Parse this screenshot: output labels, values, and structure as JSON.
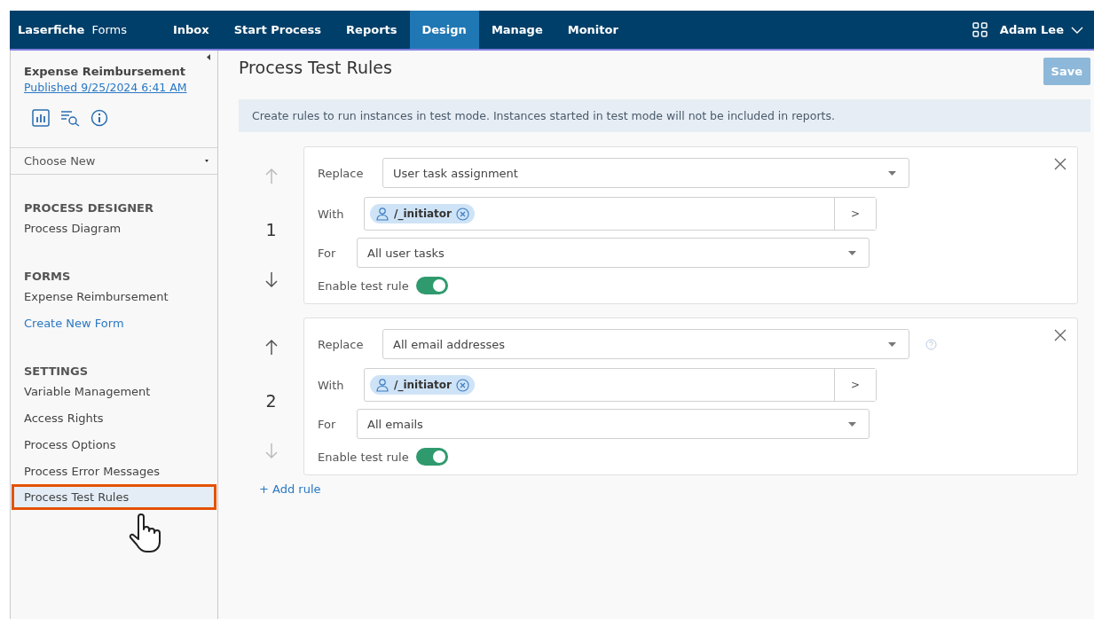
{
  "nav": {
    "brand": "Laserfiche",
    "product": "Forms",
    "tabs": [
      {
        "label": "Inbox",
        "selected": false
      },
      {
        "label": "Start Process",
        "selected": false
      },
      {
        "label": "Reports",
        "selected": false
      },
      {
        "label": "Design",
        "selected": true
      },
      {
        "label": "Manage",
        "selected": false
      },
      {
        "label": "Monitor",
        "selected": false
      }
    ],
    "user": "Adam Lee"
  },
  "sidebar": {
    "process_name": "Expense Reimbursement",
    "published": "Published 9/25/2024 6:41 AM",
    "choose": "Choose New",
    "sections": [
      {
        "heading": "PROCESS DESIGNER",
        "items": [
          {
            "label": "Process Diagram",
            "kind": "page",
            "selected": false
          }
        ]
      },
      {
        "heading": "FORMS",
        "items": [
          {
            "label": "Expense Reimbursement",
            "kind": "page",
            "selected": false
          },
          {
            "label": "Create New Form",
            "kind": "link",
            "selected": false
          }
        ]
      },
      {
        "heading": "SETTINGS",
        "items": [
          {
            "label": "Variable Management",
            "kind": "page",
            "selected": false
          },
          {
            "label": "Access Rights",
            "kind": "page",
            "selected": false
          },
          {
            "label": "Process Options",
            "kind": "page",
            "selected": false
          },
          {
            "label": "Process Error Messages",
            "kind": "page",
            "selected": false
          },
          {
            "label": "Process Test Rules",
            "kind": "page",
            "selected": true
          }
        ]
      }
    ]
  },
  "main": {
    "title": "Process Test Rules",
    "save": {
      "label": "Save",
      "disabled": true
    },
    "info": "Create rules to run instances in test mode. Instances started in test mode will not be included in reports.",
    "rules": [
      {
        "number": "1",
        "up_disabled": true,
        "down_disabled": false,
        "replace_label": "Replace",
        "replace": "User task assignment",
        "help": false,
        "with_label": "With",
        "with": "/_initiator",
        "browse": ">",
        "for_label": "For",
        "for": "All user tasks",
        "enable_label": "Enable test rule",
        "on": true
      },
      {
        "number": "2",
        "up_disabled": false,
        "down_disabled": true,
        "replace_label": "Replace",
        "replace": "All email addresses",
        "help": true,
        "with_label": "With",
        "with": "/_initiator",
        "browse": ">",
        "for_label": "For",
        "for": "All emails",
        "enable_label": "Enable test rule",
        "on": true
      }
    ],
    "add_rule": "+ Add rule"
  }
}
